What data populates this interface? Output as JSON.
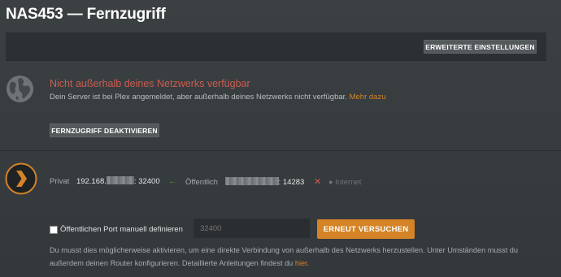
{
  "page": {
    "title": "NAS453 — Fernzugriff"
  },
  "toolbar": {
    "advanced_button": "ERWEITERTE EINSTELLUNGEN"
  },
  "status": {
    "headline": "Nicht außerhalb deines Netzwerks verfügbar",
    "description": "Dein Server ist bei Plex angemeldet, aber außerhalb deines Netzwerks nicht verfügbar.",
    "more_link": "Mehr dazu",
    "deactivate_button": "FERNZUGRIFF DEAKTIVIEREN"
  },
  "connection": {
    "private_label": "Privat",
    "private_ip_prefix": "192.168.",
    "private_port": ": 32400",
    "public_label": "Öffentlich",
    "public_port": ": 14283",
    "internet_label": "Internet"
  },
  "manual_port": {
    "checkbox_label": "Öffentlichen Port manuell definieren",
    "port_placeholder": "32400",
    "retry_button": "ERNEUT VERSUCHEN",
    "hint_text": "Du musst dies möglicherweise aktivieren, um eine direkte Verbindung von außerhalb des Netzwerks herzustellen. Unter Umständen musst du außerdem deinen Router konfigurieren. Detaillierte Anleitungen findest du ",
    "hint_link": "hier",
    "hint_end": "."
  },
  "colors": {
    "accent": "#d48326",
    "error": "#cd5c4f",
    "ok": "#5d9a39",
    "background": "#373c3f"
  },
  "icons": {
    "globe": "globe-icon",
    "plex": "plex-logo-icon",
    "arrow": "arrow-left-icon",
    "cross": "close-icon",
    "internet": "globe-small-icon"
  }
}
